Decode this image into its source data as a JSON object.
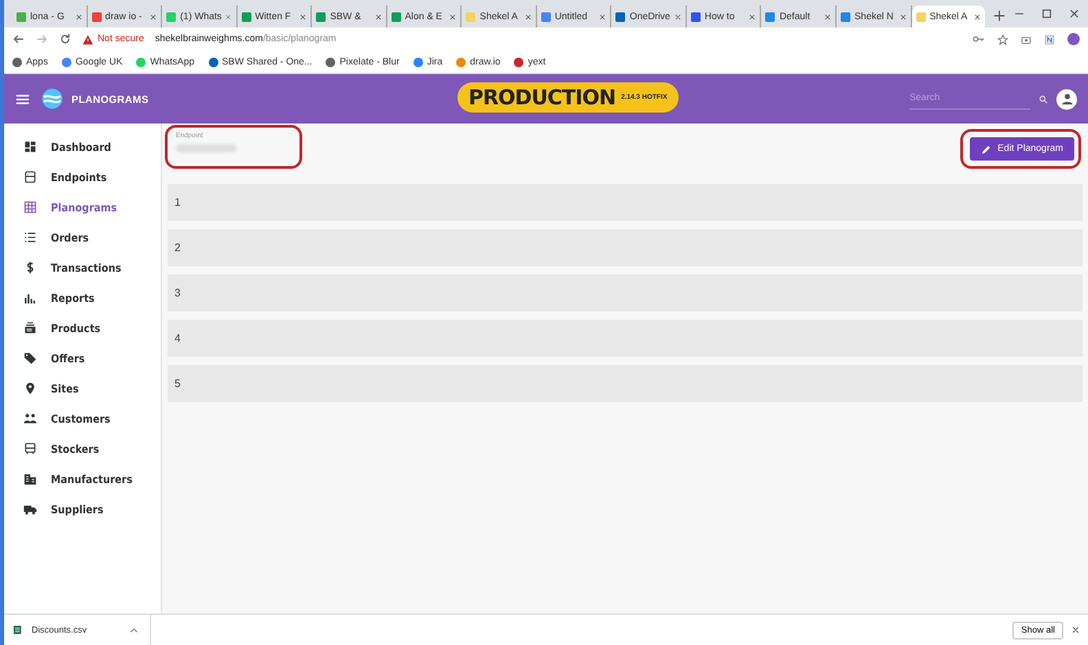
{
  "browser": {
    "tabs": [
      {
        "title": "lona - G",
        "color": "#4caf50",
        "selected": false
      },
      {
        "title": "draw io -",
        "color": "#ea4335",
        "selected": false
      },
      {
        "title": "(1) Whats",
        "color": "#25d366",
        "selected": false
      },
      {
        "title": "Witten F",
        "color": "#0f9d58",
        "selected": false
      },
      {
        "title": "SBW & ",
        "color": "#0f9d58",
        "selected": false
      },
      {
        "title": "Alon & E",
        "color": "#0f9d58",
        "selected": false
      },
      {
        "title": "Shekel A",
        "color": "#f4d35e",
        "selected": false
      },
      {
        "title": "Untitled",
        "color": "#4285f4",
        "selected": false
      },
      {
        "title": "OneDrive",
        "color": "#0364b8",
        "selected": false
      },
      {
        "title": "How to",
        "color": "#2f54eb",
        "selected": false
      },
      {
        "title": "Default",
        "color": "#1e88e5",
        "selected": false
      },
      {
        "title": "Shekel N",
        "color": "#1e88e5",
        "selected": false
      },
      {
        "title": "Shekel A",
        "color": "#f4d35e",
        "selected": true
      }
    ],
    "url_warning": "Not secure",
    "url_host": "shekelbrainweighms.com",
    "url_path": "/basic/planogram",
    "bookmarks": [
      {
        "label": "Apps",
        "color": "#5f6368"
      },
      {
        "label": "Google UK",
        "color": "#4285f4"
      },
      {
        "label": "WhatsApp",
        "color": "#25d366"
      },
      {
        "label": "SBW Shared - One...",
        "color": "#0364b8"
      },
      {
        "label": "Pixelate - Blur",
        "color": "#5f6368"
      },
      {
        "label": "Jira",
        "color": "#2684ff"
      },
      {
        "label": "draw.io",
        "color": "#f08705"
      },
      {
        "label": "yext",
        "color": "#c62828"
      }
    ]
  },
  "app_bar": {
    "title": "PLANOGRAMS",
    "environment": "PRODUCTION",
    "version": "2.14.3 HOTFIX",
    "search": {
      "placeholder": "Search"
    }
  },
  "sidebar": {
    "items": [
      {
        "label": "Dashboard",
        "selected": false
      },
      {
        "label": "Endpoints",
        "selected": false
      },
      {
        "label": "Planograms",
        "selected": true
      },
      {
        "label": "Orders",
        "selected": false
      },
      {
        "label": "Transactions",
        "selected": false
      },
      {
        "label": "Reports",
        "selected": false
      },
      {
        "label": "Products",
        "selected": false
      },
      {
        "label": "Offers",
        "selected": false
      },
      {
        "label": "Sites",
        "selected": false
      },
      {
        "label": "Customers",
        "selected": false
      },
      {
        "label": "Stockers",
        "selected": false
      },
      {
        "label": "Manufacturers",
        "selected": false
      },
      {
        "label": "Suppliers",
        "selected": false
      }
    ]
  },
  "content": {
    "endpoint_field": {
      "label": "Endpoint",
      "circled": true
    },
    "edit_button": {
      "label": "Edit Planogram",
      "circled": true
    },
    "rows": [
      "1",
      "2",
      "3",
      "4",
      "5"
    ]
  },
  "download_bar": {
    "file": "Discounts.csv",
    "show_all": "Show all"
  }
}
